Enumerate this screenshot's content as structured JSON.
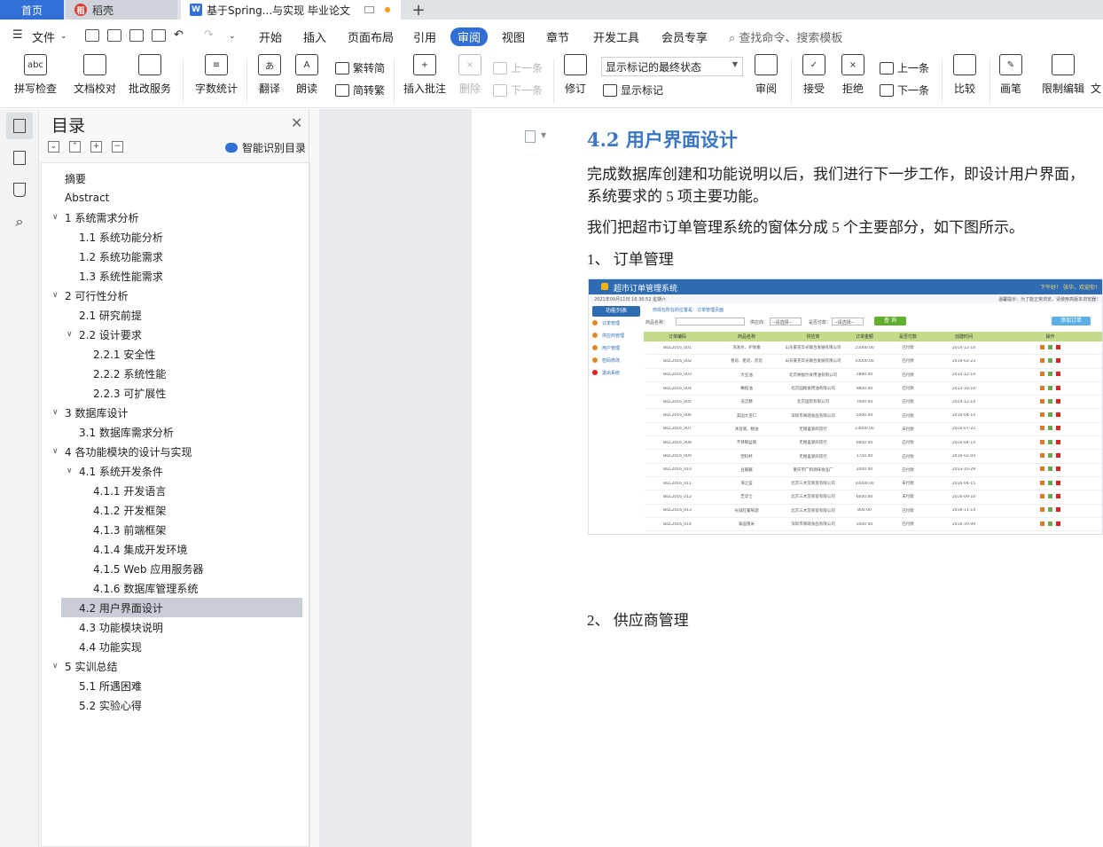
{
  "tabs": {
    "home": "首页",
    "docer": "稻壳",
    "document": "基于Spring...与实现 毕业论文",
    "docer_logo": "稻",
    "doc_logo": "W",
    "add": "+"
  },
  "menu": {
    "file": "文件",
    "items": [
      "开始",
      "插入",
      "页面布局",
      "引用",
      "审阅",
      "视图",
      "章节",
      "开发工具",
      "会员专享"
    ],
    "active": "审阅",
    "search_placeholder": "查找命令、搜索模板"
  },
  "ribbon": {
    "spell_check": "拼写检查",
    "doc_proof": "文档校对",
    "review_service": "批改服务",
    "word_count": "字数统计",
    "translate": "翻译",
    "read_aloud": "朗读",
    "trad_to_simp": "繁转简",
    "simp_to_trad": "简转繁",
    "insert_comment": "插入批注",
    "delete": "删除",
    "prev_comment": "上一条",
    "next_comment": "下一条",
    "revise": "修订",
    "markup_mode": "显示标记的最终状态",
    "show_markup": "显示标记",
    "review": "审阅",
    "accept": "接受",
    "reject": "拒绝",
    "prev_change": "上一条",
    "next_change": "下一条",
    "compare": "比较",
    "ink": "画笔",
    "restrict_edit": "限制编辑",
    "doc_cut": "文"
  },
  "toc": {
    "title": "目录",
    "smart": "智能识别目录",
    "items": [
      {
        "label": "摘要"
      },
      {
        "label": "Abstract"
      },
      {
        "label": "1 系统需求分析"
      },
      {
        "label": "1.1 系统功能分析"
      },
      {
        "label": "1.2 系统功能需求"
      },
      {
        "label": "1.3 系统性能需求"
      },
      {
        "label": "2 可行性分析"
      },
      {
        "label": "2.1 研究前提"
      },
      {
        "label": "2.2 设计要求"
      },
      {
        "label": "2.2.1 安全性"
      },
      {
        "label": "2.2.2 系统性能"
      },
      {
        "label": "2.2.3 可扩展性"
      },
      {
        "label": "3 数据库设计"
      },
      {
        "label": "3.1 数据库需求分析"
      },
      {
        "label": "4 各功能模块的设计与实现"
      },
      {
        "label": "4.1 系统开发条件"
      },
      {
        "label": "4.1.1 开发语言"
      },
      {
        "label": "4.1.2 开发框架"
      },
      {
        "label": "4.1.3 前端框架"
      },
      {
        "label": "4.1.4 集成开发环境"
      },
      {
        "label": "4.1.5 Web 应用服务器"
      },
      {
        "label": "4.1.6 数据库管理系统"
      },
      {
        "label": "4.2 用户界面设计"
      },
      {
        "label": "4.3 功能模块说明"
      },
      {
        "label": "4.4 功能实现"
      },
      {
        "label": "5 实训总结"
      },
      {
        "label": "5.1 所遇困难"
      },
      {
        "label": "5.2 实验心得"
      }
    ]
  },
  "document": {
    "heading": "4.2 用户界面设计",
    "para1_line1": "完成数据库创建和功能说明以后，我们进行下一步工作，即设计用户界面，",
    "para1_line2": "系统要求的 5 项主要功能。",
    "para2": "我们把超市订单管理系统的窗体分成 5 个主要部分，如下图所示。",
    "item1": "1、 订单管理",
    "item2": "2、 供应商管理"
  },
  "figure": {
    "title": "超市订单管理系统",
    "top_right": "下午好！ 张华，欢迎你！",
    "subbar_left": "2021年09月11日 16:36:52 星期六",
    "subbar_right": "温馨提示：为了能正常浏览，请使用高版本浏览器！",
    "nav_header": "功能列表",
    "nav_items": [
      "订单管理",
      "供应商管理",
      "用户管理",
      "密码修改",
      "退出系统"
    ],
    "crumb": "你现在所在的位置是：订单管理页面",
    "filter_product": "商品名称：",
    "filter_supplier": "供应商：",
    "filter_paid": "是否付款：",
    "filter_select": "--请选择--",
    "query_btn": "查 询",
    "add_btn": "添加订单",
    "columns": [
      "订单编码",
      "商品名称",
      "供应商",
      "订单金额",
      "是否付款",
      "创建时间",
      "操作"
    ],
    "rows": [
      [
        "BILL2016_001",
        "洗发水、护发素",
        "山东豪克华光联合发展有限公司",
        "25000.00",
        "已付款",
        "2014-12-14"
      ],
      [
        "BILL2016_002",
        "香皂、肥皂、药皂",
        "山东豪克华光联合发展有限公司",
        "10000.00",
        "已付款",
        "2016-03-23"
      ],
      [
        "BILL2016_003",
        "大豆油",
        "北京纳福尔食用油有限公司",
        "5890.00",
        "已付款",
        "2014-12-14"
      ],
      [
        "BILL2016_004",
        "橄榄油",
        "北京国粮食用油有限公司",
        "9800.00",
        "已付款",
        "2013-10-10"
      ],
      [
        "BILL2016_005",
        "洗洁精",
        "北京国贸有限公司",
        "7000.00",
        "已付款",
        "2014-12-14"
      ],
      [
        "BILL2016_006",
        "美国大杏仁",
        "深圳市果疏食品有限公司",
        "5000.00",
        "已付款",
        "2016-04-14"
      ],
      [
        "BILL2016_007",
        "沐浴液、精油",
        "无锡喜源商贸行",
        "23000.00",
        "未付款",
        "2016-07-22"
      ],
      [
        "BILL2016_008",
        "不锈钢盆碗",
        "无锡喜源商贸行",
        "6000.00",
        "已付款",
        "2016-04-14"
      ],
      [
        "BILL2016_009",
        "塑料杯",
        "无锡喜源商贸行",
        "1750.00",
        "已付款",
        "2016-02-04"
      ],
      [
        "BILL2016_010",
        "豆瓣酱",
        "重庆市广和调味食品厂",
        "2000.00",
        "已付款",
        "2013-10-29"
      ],
      [
        "BILL2016_011",
        "海之蓝",
        "北京三木堂商贸有限公司",
        "10000.00",
        "未付款",
        "2016-04-15"
      ],
      [
        "BILL2016_012",
        "芝华士",
        "北京三木堂商贸有限公司",
        "6000.00",
        "未付款",
        "2016-09-10"
      ],
      [
        "BILL2016_013",
        "长城红葡萄酒",
        "北京三木堂商贸有限公司",
        "800.00",
        "已付款",
        "2016-11-14"
      ],
      [
        "BILL2016_014",
        "泰国香米",
        "深圳市果疏食品有限公司",
        "5000.00",
        "已付款",
        "2016-10-09"
      ]
    ]
  }
}
